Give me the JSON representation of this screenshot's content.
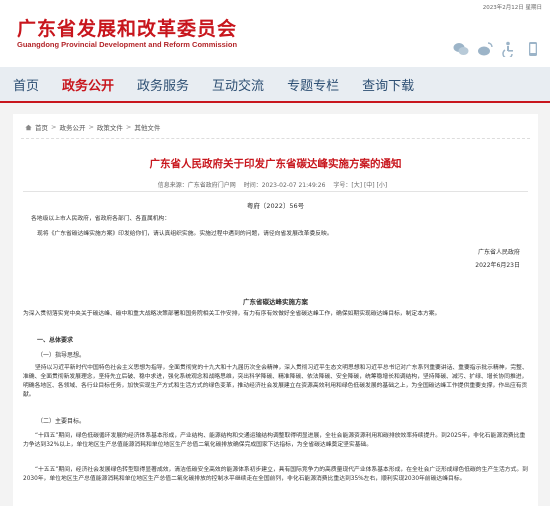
{
  "header": {
    "date": "2023年2月12日  星期日",
    "logo_cn": "广东省发展和改革委员会",
    "logo_en": "Guangdong Provincial Development and Reform Commission",
    "icons": [
      "wechat-icon",
      "weibo-icon",
      "accessibility-icon",
      "mobile-icon"
    ]
  },
  "nav": {
    "items": [
      "首页",
      "政务公开",
      "政务服务",
      "互动交流",
      "专题专栏",
      "查询下载"
    ],
    "active_index": 1
  },
  "breadcrumb": {
    "items": [
      "首页",
      "政务公开",
      "政策文件",
      "其他文件"
    ]
  },
  "document": {
    "title": "广东省人民政府关于印发广东省碳达峰实施方案的通知",
    "source_label": "信息来源：广东省政府门户网",
    "time_label": "时间：2023-02-07 21:49:26",
    "size_label": "字号：[大] [中] [小]",
    "number": "粤府〔2022〕56号",
    "recipients": "各地级以上市人民政府，省政府各部门、各直属机构：",
    "body1": "现将《广东省碳达峰实施方案》印发给你们，请认真组织实施。实施过程中遇到的问题，请径向省发展改革委反映。",
    "signature_org": "广东省人民政府",
    "signature_date": "2022年6月23日",
    "plan_title": "广东省碳达峰实施方案",
    "intro": "为深入贯彻落实党中央关于碳达峰、碳中和重大战略决策部署和国务院相关工作安排，有力有序有效做好全省碳达峰工作，确保如期实现碳达峰目标，制定本方案。",
    "section1": "一、总体要求",
    "sub1": "（一）指导思想。",
    "para1": "坚持以习近平新时代中国特色社会主义思想为指导，全面贯彻党的十九大和十九届历次全会精神，深入贯彻习近平生态文明思想和习近平总书记对广东系列重要讲话、重要指示批示精神，完整、准确、全面贯彻新发展理念，坚持先立后破、稳中求进，强化系统观念和战略思维，突出科学降碳、精准降碳、依法降碳、安全降碳，统筹稳增长和调结构，坚持降碳、减污、扩绿、增长协同推进，明确各地区、各领域、各行业目标任务，加快实现生产方式和生活方式的绿色变革，推动经济社会发展建立在资源高效利用和绿色低碳发展的基础之上，为全国碳达峰工作提供重要支撑，作出应有贡献。",
    "sub2": "（二）主要目标。",
    "para2": "“十四五”期间，绿色低碳循环发展的经济体系基本形成，产业结构、能源结构和交通运输结构调整取得明显进展，全社会能源资源利用和碳排放效率持续提升。到2025年，非化石能源消费比重力争达到32%以上，单位地区生产总值能源消耗和单位地区生产总值二氧化碳排放确保完成国家下达指标，为全省碳达峰奠定坚实基础。",
    "para3": "“十五五”期间，经济社会发展绿色转型取得显著成效，清洁低碳安全高效的能源体系初步建立，具有国际竞争力的高质量现代产业体系基本形成，在全社会广泛形成绿色低碳的生产生活方式。到2030年，单位地区生产总值能源消耗和单位地区生产总值二氧化碳排放的控制水平继续走在全国前列，非化石能源消费比重达到35%左右，顺利实现2030年前碳达峰目标。"
  },
  "colors": {
    "brand_red": "#c8161d",
    "nav_blue": "#2d4f73",
    "nav_bg": "#e8edf2"
  }
}
